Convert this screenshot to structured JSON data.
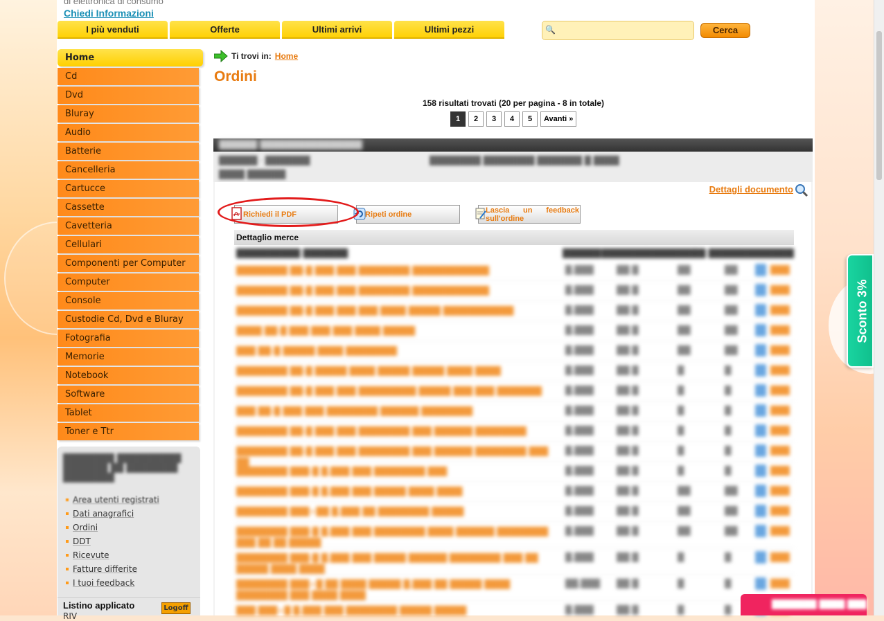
{
  "header": {
    "tagline": "di elettronica di consumo",
    "info_link": "Chiedi Informazioni"
  },
  "topnav": [
    {
      "label": "I più venduti"
    },
    {
      "label": "Offerte"
    },
    {
      "label": "Ultimi arrivi"
    },
    {
      "label": "Ultimi pezzi"
    }
  ],
  "search": {
    "placeholder": "",
    "button": "Cerca"
  },
  "sidebar": {
    "items": [
      {
        "label": "Home"
      },
      {
        "label": "Cd"
      },
      {
        "label": "Dvd"
      },
      {
        "label": "Bluray"
      },
      {
        "label": "Audio"
      },
      {
        "label": "Batterie"
      },
      {
        "label": "Cancelleria"
      },
      {
        "label": "Cartucce"
      },
      {
        "label": "Cassette"
      },
      {
        "label": "Cavetteria"
      },
      {
        "label": "Cellulari"
      },
      {
        "label": "Componenti per Computer"
      },
      {
        "label": "Computer"
      },
      {
        "label": "Console"
      },
      {
        "label": "Custodie Cd, Dvd e Bluray"
      },
      {
        "label": "Fotografia"
      },
      {
        "label": "Memorie"
      },
      {
        "label": "Notebook"
      },
      {
        "label": "Software"
      },
      {
        "label": "Tablet"
      },
      {
        "label": "Toner e Ttr"
      }
    ]
  },
  "user_box": {
    "links": [
      {
        "label": "Area utenti registrati"
      },
      {
        "label": "Dati anagrafici"
      },
      {
        "label": "Ordini"
      },
      {
        "label": "DDT"
      },
      {
        "label": "Ricevute"
      },
      {
        "label": "Fatture differite"
      },
      {
        "label": "I tuoi feedback"
      }
    ],
    "listino_label": "Listino applicato",
    "listino_value": "RIV",
    "logoff": "Logoff"
  },
  "breadcrumb": {
    "prefix": "Ti trovi in:",
    "home": "Home"
  },
  "page_title": "Ordini",
  "results": {
    "summary": "158 risultati trovati (20 per pagina - 8 in totale)",
    "pages": [
      "1",
      "2",
      "3",
      "4",
      "5"
    ],
    "current_page": "1",
    "next": "Avanti »"
  },
  "order": {
    "details_link": "Dettagli documento",
    "buttons": {
      "pdf": "Richiedi il PDF",
      "repeat": "Ripeti ordine",
      "feedback": "Lascia un feedback sull'ordine"
    },
    "section_title": "Dettaglio merce"
  },
  "promo": {
    "discount": "Sconto 3%"
  },
  "colors": {
    "accent": "#ff8c1a",
    "nav_yellow": "#ffd000",
    "highlight": "#e21b1b",
    "promo": "#19d4a0"
  }
}
